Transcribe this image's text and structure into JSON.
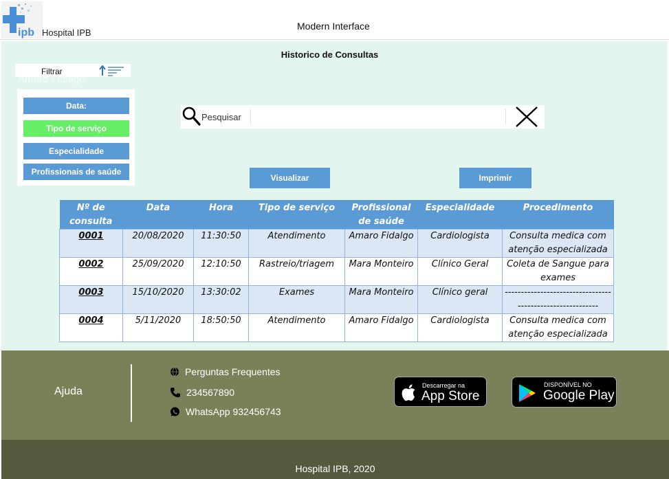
{
  "header": {
    "hospital_name": "Hospital IPB",
    "title": "Modern Interface"
  },
  "page": {
    "title": "Historico de Consultas",
    "ghost_text": "Amaro Fidalgo"
  },
  "filter": {
    "label": "Filtrar",
    "options": [
      {
        "label": "Data:",
        "color": "#5b9bd5"
      },
      {
        "label": "Tipo de serviço",
        "color": "#66ee66"
      },
      {
        "label": "Especialidade",
        "color": "#5b9bd5"
      },
      {
        "label": "Profissionais de saúde",
        "color": "#5b9bd5"
      }
    ]
  },
  "search": {
    "label": "Pesquisar",
    "value": ""
  },
  "actions": {
    "view_label": "Visualizar",
    "print_label": "Imprimir"
  },
  "table": {
    "headers": [
      "Nº de consulta",
      "Data",
      "Hora",
      "Tipo de serviço",
      "Profissional de saúde",
      "Especialidade",
      "Procedimento"
    ],
    "rows": [
      [
        "0001",
        "20/08/2020",
        "11:30:50",
        "Atendimento",
        "Amaro Fidalgo",
        "Cardiologista",
        "Consulta medica com atenção especializada"
      ],
      [
        "0002",
        "25/09/2020",
        "12:10:50",
        "Rastreio/triagem",
        "Mara Monteiro",
        "Clínico Geral",
        "Coleta de Sangue para exames"
      ],
      [
        "0003",
        "15/10/2020",
        "13:30:02",
        "Exames",
        "Mara Monteiro",
        "Clínico geral",
        "----------------------------------------------------------"
      ],
      [
        "0004",
        "5/11/2020",
        "18:50:50",
        "Atendimento",
        "Amaro Fidalgo",
        "Cardiologista",
        "Consulta medica com atenção especializada"
      ]
    ]
  },
  "footer": {
    "help_label": "Ajuda",
    "faq": "Perguntas Frequentes",
    "phone": "234567890",
    "whatsapp": "WhatsApp 932456743",
    "app_store_small": "Descarregar na",
    "app_store_big": "App Store",
    "google_play_small": "DISPONÍVEL NO",
    "google_play_big": "Google Play"
  },
  "colors": {
    "accent": "#5b9bd5",
    "highlight": "#66ee66",
    "main_bg": "#e3f5ef",
    "footer_bg": "#7a8159",
    "bottom_bg": "#555a3f"
  },
  "copyright": "Hospital IPB, 2020"
}
